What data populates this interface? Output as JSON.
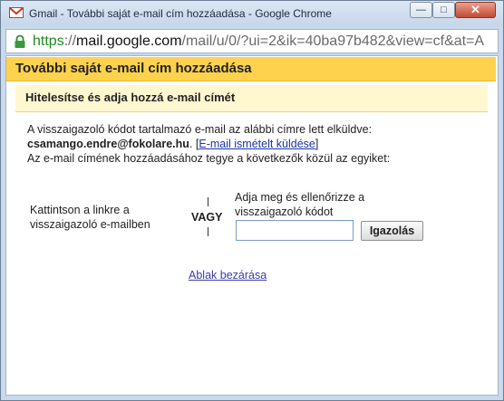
{
  "window": {
    "title": "Gmail - További saját e-mail cím hozzáadása - Google Chrome",
    "min_glyph": "—",
    "max_glyph": "□",
    "close_glyph": "✕"
  },
  "address": {
    "scheme": "https",
    "separator": "://",
    "host": "mail.google.com",
    "path": "/mail/u/0/?ui=2&ik=40ba97b482&view=cf&at=A"
  },
  "dialog": {
    "title": "További saját e-mail cím hozzáadása",
    "subheader": "Hitelesítse és adja hozzá e-mail címét",
    "line1": "A visszaigazoló kódot tartalmazó e-mail az alábbi címre lett elküldve:",
    "email": "csamango.endre@fokolare.hu",
    "period": ".",
    "resend_open": "[",
    "resend_label": "E-mail ismételt küldése",
    "resend_close": "]",
    "line3": "Az e-mail címének hozzáadásához tegye a következők közül az egyiket:",
    "option1_line1": "Kattintson a linkre a",
    "option1_line2": "visszaigazoló e-mailben",
    "or_label": "VAGY",
    "option2_line1": "Adja meg és ellenőrizze a",
    "option2_line2": "visszaigazoló kódot",
    "code_value": "",
    "verify_button": "Igazolás",
    "close_link": "Ablak bezárása"
  },
  "colors": {
    "header_bg": "#ffd24d",
    "subheader_bg": "#fff7d0",
    "link": "#3b3bb0",
    "https_green": "#1e8a1e"
  },
  "icons": {
    "app": "gmail-icon",
    "security": "lock-icon"
  }
}
